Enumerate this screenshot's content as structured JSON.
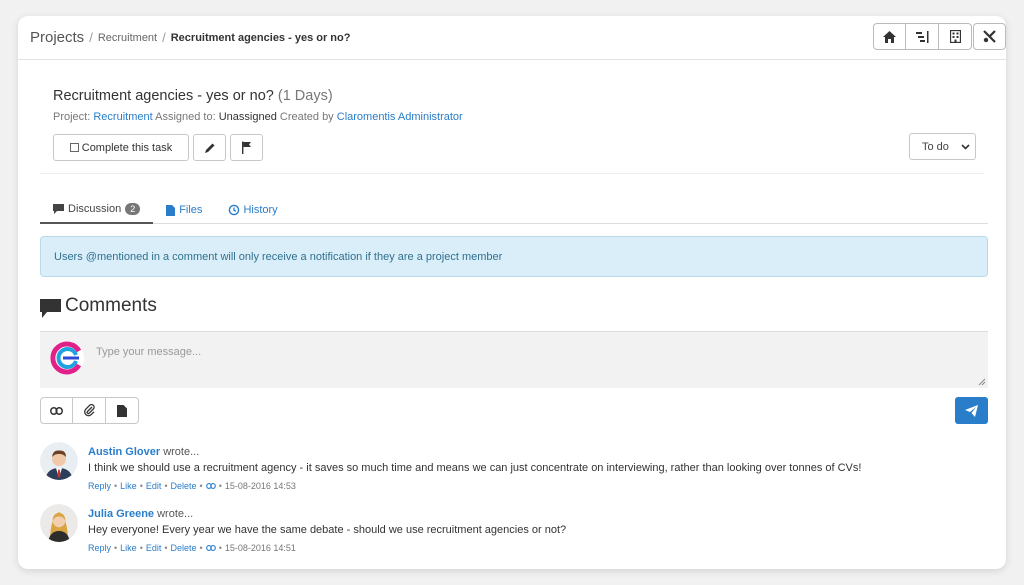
{
  "breadcrumb": {
    "root": "Projects",
    "parent": "Recruitment",
    "current": "Recruitment agencies - yes or no?"
  },
  "task": {
    "title": "Recruitment agencies - yes or no?",
    "duration": "(1 Days)",
    "project_label": "Project:",
    "project": "Recruitment",
    "assigned_label": "Assigned to:",
    "assigned": "Unassigned",
    "created_label": "Created by",
    "creator": "Claromentis Administrator",
    "complete_label": "Complete this task",
    "status": "To do"
  },
  "tabs": [
    {
      "label": "Discussion",
      "count": "2"
    },
    {
      "label": "Files"
    },
    {
      "label": "History"
    }
  ],
  "alert": "Users @mentioned in a comment will only receive a notification if they are a project member",
  "comments_heading": "Comments",
  "composer": {
    "placeholder": "Type your message..."
  },
  "comment_actions": {
    "reply": "Reply",
    "like": "Like",
    "edit": "Edit",
    "delete": "Delete"
  },
  "comments": [
    {
      "author": "Austin Glover",
      "wrote": "wrote...",
      "text": "I think we should use a recruitment agency - it saves so much time and means we can just concentrate on interviewing, rather than looking over tonnes of CVs!",
      "date": "15-08-2016 14:53"
    },
    {
      "author": "Julia Greene",
      "wrote": "wrote...",
      "text": "Hey everyone! Every year we have the same debate - should we use recruitment agencies or not?",
      "date": "15-08-2016 14:51"
    }
  ],
  "colors": {
    "accent": "#2a7dc9",
    "alert_bg": "#d9eef8",
    "alert_text": "#31708f"
  }
}
